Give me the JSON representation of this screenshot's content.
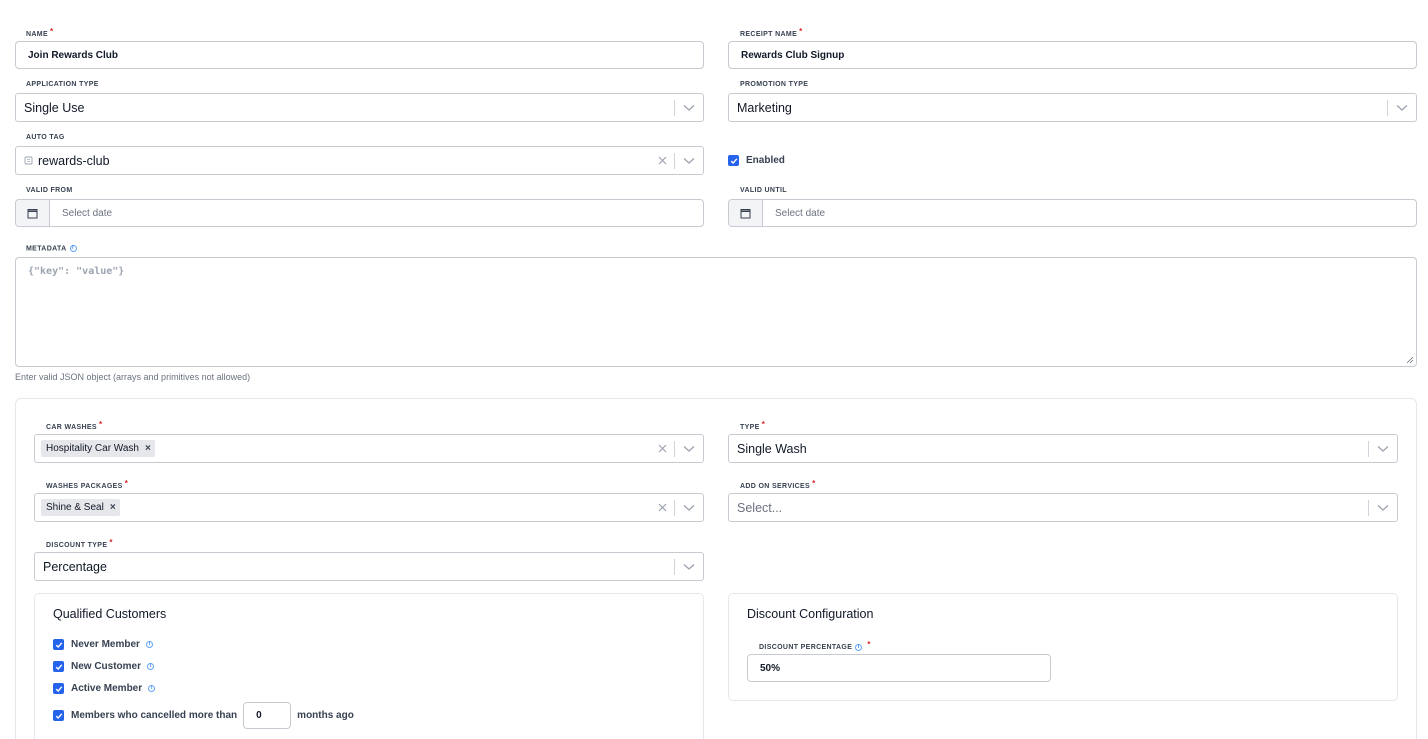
{
  "form": {
    "name": {
      "label": "NAME",
      "value": "Join Rewards Club"
    },
    "receipt_name": {
      "label": "RECEIPT NAME",
      "value": "Rewards Club Signup"
    },
    "application_type": {
      "label": "APPLICATION TYPE",
      "value": "Single Use"
    },
    "promotion_type": {
      "label": "PROMOTION TYPE",
      "value": "Marketing"
    },
    "auto_tag": {
      "label": "AUTO TAG",
      "value": "rewards-club"
    },
    "enabled": {
      "label": "Enabled",
      "checked": true
    },
    "valid_from": {
      "label": "VALID FROM",
      "placeholder": "Select date"
    },
    "valid_until": {
      "label": "VALID UNTIL",
      "placeholder": "Select date"
    },
    "metadata": {
      "label": "METADATA",
      "placeholder": "{\"key\": \"value\"}",
      "help": "Enter valid JSON object (arrays and primitives not allowed)"
    }
  },
  "rules": {
    "car_washes": {
      "label": "CAR WASHES",
      "chips": [
        "Hospitality Car Wash"
      ]
    },
    "type": {
      "label": "TYPE",
      "value": "Single Wash"
    },
    "washes_packages": {
      "label": "WASHES PACKAGES",
      "chips": [
        "Shine & Seal"
      ]
    },
    "add_on_services": {
      "label": "ADD ON SERVICES",
      "placeholder": "Select..."
    },
    "discount_type": {
      "label": "DISCOUNT TYPE",
      "value": "Percentage"
    },
    "chip_remove": "×",
    "clear_symbol": "✕"
  },
  "qualified_customers": {
    "title": "Qualified Customers",
    "options": [
      {
        "label": "Never Member",
        "checked": true
      },
      {
        "label": "New Customer",
        "checked": true
      },
      {
        "label": "Active Member",
        "checked": true
      }
    ],
    "cancelled": {
      "label": "Members who cancelled more than",
      "value": "0",
      "suffix": "months ago",
      "checked": true
    }
  },
  "discount_configuration": {
    "title": "Discount Configuration",
    "percentage": {
      "label": "DISCOUNT PERCENTAGE",
      "value": "50%"
    }
  },
  "icons": {
    "chevron": "chevron-down-icon",
    "clear": "close-icon",
    "calendar": "calendar-icon",
    "tag": "tag-icon",
    "info": "info-icon",
    "check": "check-icon"
  },
  "colors": {
    "accent": "#2563eb",
    "required": "#dc2626",
    "info": "#3b82f6",
    "border": "#c7cbd1"
  }
}
